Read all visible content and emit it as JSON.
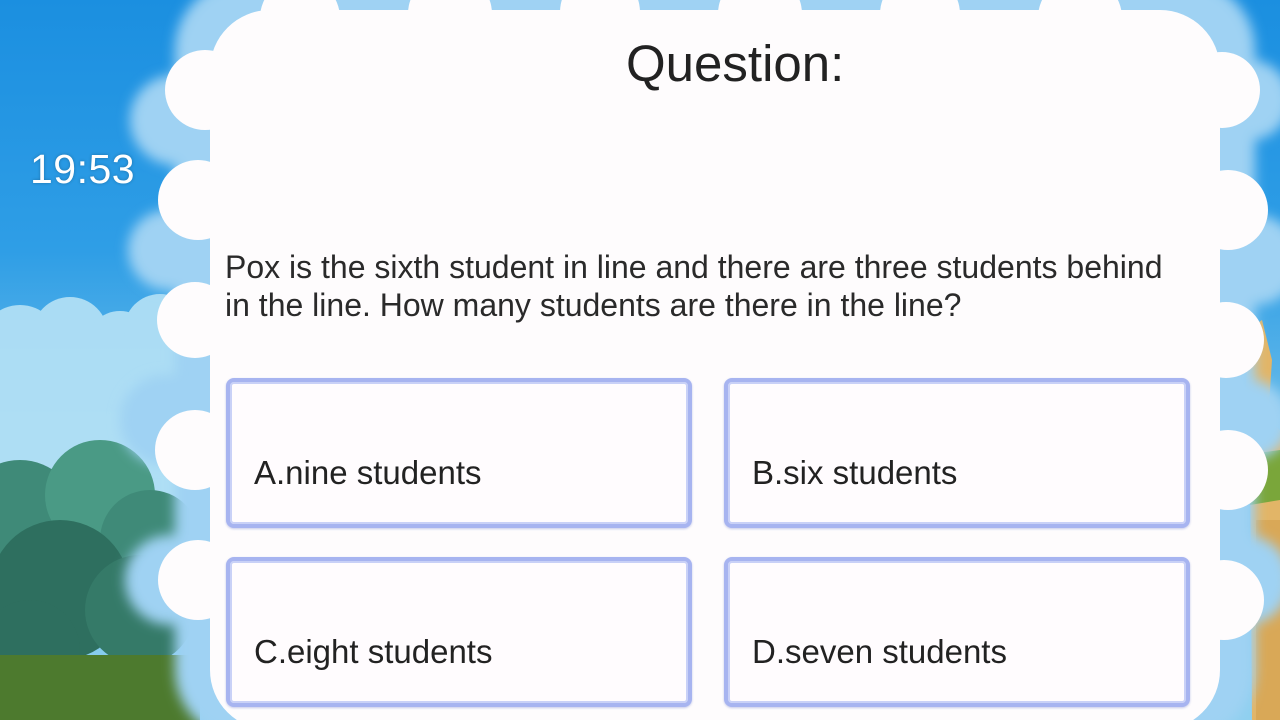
{
  "timer": "19:53",
  "question": {
    "title": "Question:",
    "text": "Pox is the sixth student in line and there are three students behind in the line. How many students are there in the line?"
  },
  "answers": [
    {
      "label": "A.nine students"
    },
    {
      "label": "B.six students"
    },
    {
      "label": "C.eight students"
    },
    {
      "label": "D.seven students"
    }
  ],
  "colors": {
    "sky": "#2f9ee6",
    "card": "#fffcfe",
    "answer_border": "#a7b4f0",
    "text": "#222222"
  }
}
